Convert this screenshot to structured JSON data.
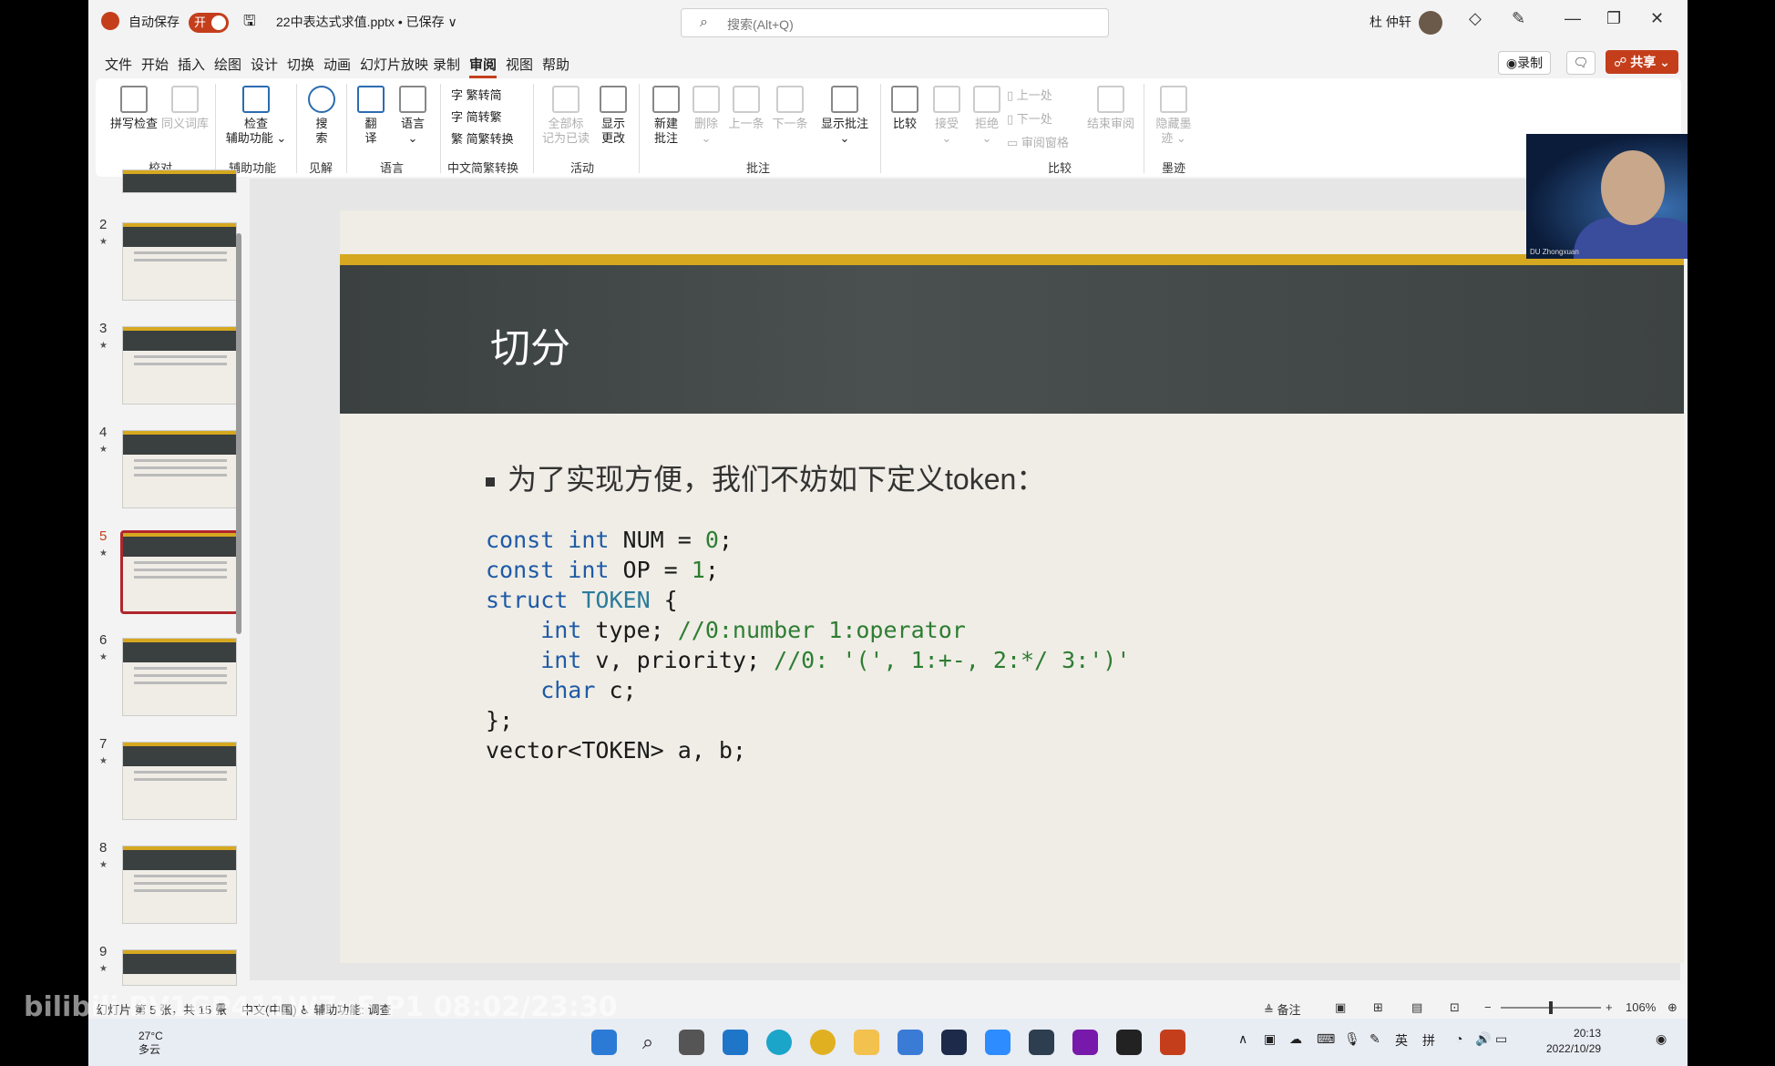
{
  "titlebar": {
    "autosave_label": "自动保存",
    "autosave_state": "开",
    "filename": "22中表达式求值.pptx • 已保存 ∨",
    "search_placeholder": "搜索(Alt+Q)",
    "user_name": "杜 仲轩"
  },
  "menu": [
    "文件",
    "开始",
    "插入",
    "绘图",
    "设计",
    "切换",
    "动画",
    "幻灯片放映",
    "录制",
    "审阅",
    "视图",
    "帮助"
  ],
  "menu_active": "审阅",
  "actions": {
    "record": "◉录制",
    "share": "☍ 共享 ⌄"
  },
  "ribbon": {
    "spell": "拼写检查",
    "thesaurus": "同义词库",
    "check_access": "检查",
    "check_access2": "辅助功能 ⌄",
    "search": "搜",
    "search2": "索",
    "translate": "翻",
    "translate2": "译",
    "language": "语言",
    "trad": "繁转简",
    "simp": "简转繁",
    "convert": "简繁转换",
    "all_read": "全部标",
    "all_read2": "记为已读",
    "show_changes": "显示",
    "show_changes2": "更改",
    "new_comment": "新建",
    "new_comment2": "批注",
    "delete": "删除",
    "prev": "上一条",
    "next": "下一条",
    "show_comments": "显示批注",
    "compare": "比较",
    "accept": "接受",
    "reject": "拒绝",
    "prev_change": "上一处",
    "next_change": "下一处",
    "review_pane": "审阅窗格",
    "end_review": "结束审阅",
    "hide_ink": "隐藏墨",
    "hide_ink2": "迹 ⌄",
    "groups": {
      "proofing": "校对",
      "accessibility": "辅助功能",
      "insights": "见解",
      "language": "语言",
      "chinese": "中文简繁转换",
      "activity": "活动",
      "comments": "批注",
      "compare": "比较",
      "ink": "墨迹"
    }
  },
  "slides": [
    {
      "num": "2"
    },
    {
      "num": "3"
    },
    {
      "num": "4"
    },
    {
      "num": "5"
    },
    {
      "num": "6"
    },
    {
      "num": "7"
    },
    {
      "num": "8"
    },
    {
      "num": "9"
    }
  ],
  "current_slide": "5",
  "slide": {
    "title": "切分",
    "bullet": "为了实现方便，我们不妨如下定义token："
  },
  "code": {
    "l1_kw": "const int",
    "l1_rest": " NUM = ",
    "l1_num": "0",
    "l1_end": ";",
    "l2_kw": "const int",
    "l2_rest": " OP = ",
    "l2_num": "1",
    "l2_end": ";",
    "l3_kw": "struct",
    "l3_ty": " TOKEN",
    "l3_end": " {",
    "l4_kw": "    int",
    "l4_rest": " type; ",
    "l4_cm": "//0:number 1:operator",
    "l5_kw": "    int",
    "l5_rest": " v, priority; ",
    "l5_cm": "//0: '(', 1:+-, 2:*/ 3:')'",
    "l6_kw": "    char",
    "l6_rest": " c;",
    "l7": "};",
    "l8": "vector<TOKEN> a, b;"
  },
  "webcam_label": "DU Zhongxuan",
  "status": {
    "slide_info": "幻灯片 第 5 张，共 15 张",
    "lang": "中文(中国)",
    "access": "辅助功能: 调查",
    "notes": "≜ 备注",
    "zoom": "106%"
  },
  "taskbar": {
    "temp": "27°C",
    "weather": "多云",
    "ime1": "英",
    "ime2": "拼",
    "time": "20:13",
    "date": "2022/10/29"
  },
  "watermark": "bilibili BV1GP411W7uF P1 08:02/23:30",
  "colors": {
    "accent": "#c43e1c",
    "slide_gold": "#d6a820",
    "slide_dark": "#3b4040"
  }
}
